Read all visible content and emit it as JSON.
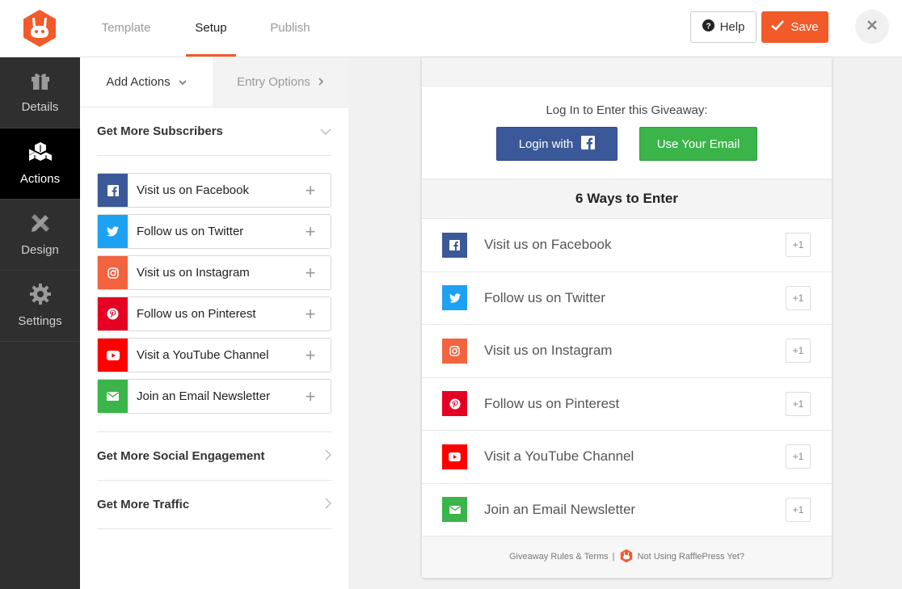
{
  "header": {
    "tabs": [
      {
        "label": "Template",
        "active": false
      },
      {
        "label": "Setup",
        "active": true
      },
      {
        "label": "Publish",
        "active": false
      }
    ],
    "help_label": "Help",
    "save_label": "Save",
    "accent_color": "#f25a2a"
  },
  "sidebar": {
    "items": [
      {
        "label": "Details",
        "icon": "gift-icon",
        "active": false
      },
      {
        "label": "Actions",
        "icon": "cubes-icon",
        "active": true
      },
      {
        "label": "Design",
        "icon": "pencil-ruler-icon",
        "active": false
      },
      {
        "label": "Settings",
        "icon": "gear-icon",
        "active": false
      }
    ]
  },
  "panel": {
    "subtabs": [
      {
        "label": "Add Actions",
        "icon": "chevron-down-icon"
      },
      {
        "label": "Entry Options",
        "icon": "chevron-right-icon"
      }
    ],
    "sections": [
      {
        "title": "Get More Subscribers",
        "expanded": true
      },
      {
        "title": "Get More Social Engagement",
        "expanded": false
      },
      {
        "title": "Get More Traffic",
        "expanded": false
      }
    ],
    "actions": [
      {
        "label": "Visit us on Facebook",
        "icon": "facebook-icon",
        "color": "#3b5998"
      },
      {
        "label": "Follow us on Twitter",
        "icon": "twitter-icon",
        "color": "#1da1f2"
      },
      {
        "label": "Visit us on Instagram",
        "icon": "instagram-icon",
        "color": "#f2633f"
      },
      {
        "label": "Follow us on Pinterest",
        "icon": "pinterest-icon",
        "color": "#e60023"
      },
      {
        "label": "Visit a YouTube Channel",
        "icon": "youtube-icon",
        "color": "#ff0000"
      },
      {
        "label": "Join an Email Newsletter",
        "icon": "email-icon",
        "color": "#3bb44a"
      }
    ],
    "add_symbol": "+"
  },
  "preview": {
    "login_prompt": "Log In to Enter this Giveaway:",
    "login_facebook_label": "Login with",
    "login_email_label": "Use Your Email",
    "ways_title": "6 Ways to Enter",
    "entries": [
      {
        "label": "Visit us on Facebook",
        "points": "+1",
        "icon": "facebook-icon",
        "color": "#3b5998"
      },
      {
        "label": "Follow us on Twitter",
        "points": "+1",
        "icon": "twitter-icon",
        "color": "#1da1f2"
      },
      {
        "label": "Visit us on Instagram",
        "points": "+1",
        "icon": "instagram-icon",
        "color": "#f2633f"
      },
      {
        "label": "Follow us on Pinterest",
        "points": "+1",
        "icon": "pinterest-icon",
        "color": "#e60023"
      },
      {
        "label": "Visit a YouTube Channel",
        "points": "+1",
        "icon": "youtube-icon",
        "color": "#ff0000"
      },
      {
        "label": "Join an Email Newsletter",
        "points": "+1",
        "icon": "email-icon",
        "color": "#3bb44a"
      }
    ],
    "footer_rules": "Giveaway Rules & Terms",
    "footer_separator": "|",
    "footer_cta": "Not Using RafflePress Yet?"
  }
}
